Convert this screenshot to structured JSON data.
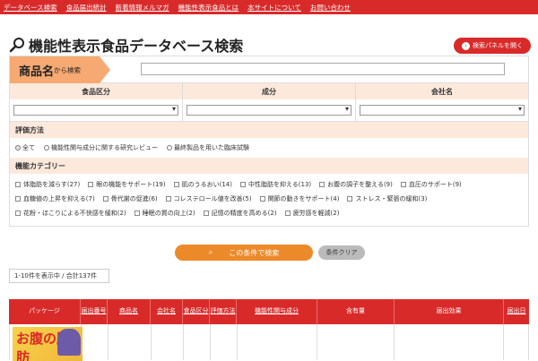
{
  "nav": [
    "データベース検索",
    "食品届出統計",
    "新着情報メルマガ",
    "機能性表示食品とは",
    "本サイトについて",
    "お問い合わせ"
  ],
  "header": {
    "title": "機能性表示食品データベース検索",
    "panel_button": "検索パネルを開く"
  },
  "search": {
    "name_label_big": "商品名",
    "name_label_small": "から検索",
    "name_value": "",
    "columns": [
      "食品区分",
      "成分",
      "会社名"
    ]
  },
  "evaluation": {
    "heading": "評価方法",
    "options": [
      "全て",
      "機能性関与成分に関する研究レビュー",
      "最終製品を用いた臨床試験"
    ]
  },
  "category": {
    "heading": "機能カテゴリー",
    "line1": [
      "体脂肪を減らす(27)",
      "眼の機能をサポート(19)",
      "肌のうるおい(14)",
      "中性脂肪を抑える(13)",
      "お腹の調子を整える(9)",
      "血圧のサポート(9)"
    ],
    "line2": [
      "血糖値の上昇を抑える(7)",
      "骨代謝の促進(6)",
      "コレステロール値を改善(5)",
      "関節の動きをサポート(4)",
      "ストレス・緊張の緩和(3)"
    ],
    "line3": [
      "花粉・ほこりによる不快感を緩和(2)",
      "睡眠の質の向上(2)",
      "記憶の精度を高める(2)",
      "疲労感を軽減(2)"
    ]
  },
  "actions": {
    "search": "この条件で検索",
    "clear": "条件クリア"
  },
  "result_count": "1-10件を表示中 / 合計137件",
  "table": {
    "headers": [
      "パッケージ",
      "届出番号",
      "商品名",
      "会社名",
      "食品区分",
      "評価方法",
      "機能性関与成分",
      "含有量",
      "届出効果",
      "届出日"
    ],
    "first_package_text": "お腹の脂肪"
  },
  "colors": {
    "brand": "#d92a2a",
    "orange": "#ec8a2a",
    "peach": "#fde9dc"
  }
}
